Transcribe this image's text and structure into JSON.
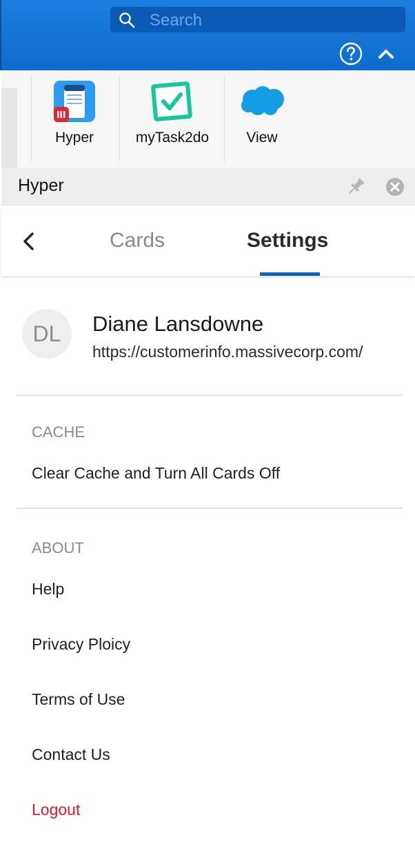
{
  "header": {
    "search_placeholder": "Search",
    "icons": {
      "search": "search-icon",
      "help": "help-circle-icon",
      "collapse": "chevron-up-icon"
    }
  },
  "apps": [
    {
      "label": "Hyper",
      "icon": "hyper-app-icon"
    },
    {
      "label": "myTask2do",
      "icon": "checkmark-app-icon"
    },
    {
      "label": "View",
      "icon": "salesforce-cloud-icon"
    }
  ],
  "pinbar": {
    "title": "Hyper",
    "icons": {
      "pin": "pin-icon",
      "close": "close-circle-icon"
    }
  },
  "tabs": {
    "back_icon": "chevron-left-icon",
    "cards": "Cards",
    "settings": "Settings",
    "active": "Settings"
  },
  "profile": {
    "initials": "DL",
    "name": "Diane Lansdowne",
    "url": "https://customerinfo.massivecorp.com/"
  },
  "cache": {
    "heading": "CACHE",
    "clear_label": "Clear Cache and Turn All Cards Off"
  },
  "about": {
    "heading": "ABOUT",
    "help": "Help",
    "privacy": "Privacy Ploicy",
    "terms": "Terms of Use",
    "contact": "Contact Us"
  },
  "logout": "Logout",
  "colors": {
    "brand_blue": "#1a7de0",
    "tab_accent": "#0e62c0",
    "logout_red": "#e0182e"
  }
}
